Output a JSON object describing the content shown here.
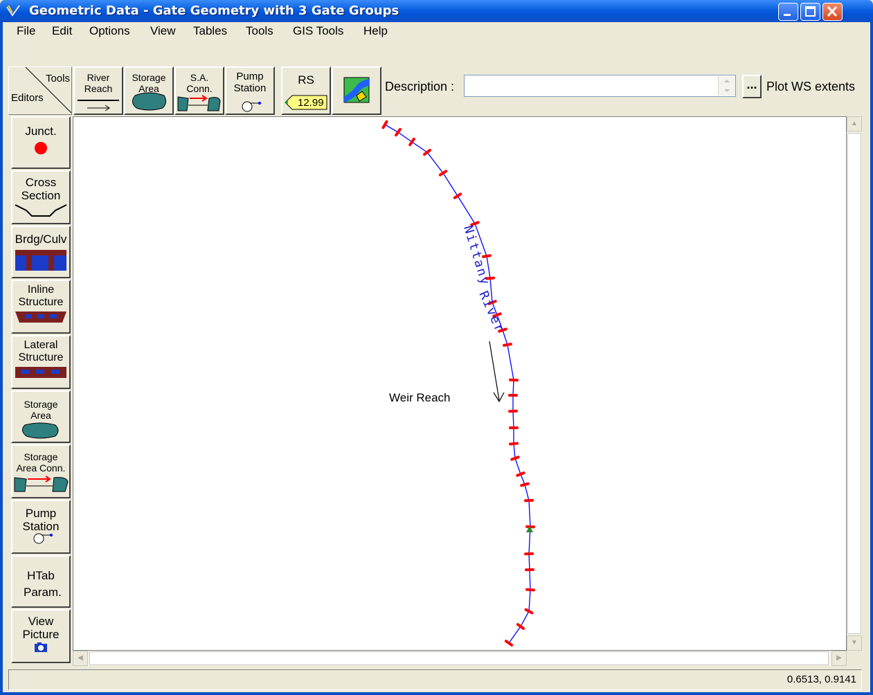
{
  "window": {
    "title": "Geometric Data - Gate Geometry with 3 Gate Groups",
    "colors": {
      "titlebar": "#0553d8",
      "background": "#ece9d8",
      "river_line": "#0000ff",
      "cross_section": "#ff0000"
    }
  },
  "menu": [
    "File",
    "Edit",
    "Options",
    "View",
    "Tables",
    "Tools",
    "GIS Tools",
    "Help"
  ],
  "toolbar": {
    "corner_tools": "Tools",
    "corner_editors": "Editors",
    "river_reach": "River Reach",
    "storage_area": "Storage Area",
    "sa_conn": "S.A. Conn.",
    "pump_station": "Pump Station",
    "rs_label": "RS",
    "rs_value": "12.99",
    "description_label": "Description :",
    "description_value": "",
    "dots_label": "...",
    "plot_ws": "Plot WS extents"
  },
  "side_buttons": {
    "junct": "Junct.",
    "cross_section": "Cross Section",
    "brdg_culv": "Brdg/Culv",
    "inline_structure": "Inline Structure",
    "lateral_structure": "Lateral Structure",
    "storage_area": "Storage Area",
    "storage_area_conn": "Storage Area Conn.",
    "pump_station": "Pump Station",
    "htab_param": "HTab Param.",
    "view_picture": "View Picture"
  },
  "canvas": {
    "river_name": "Nittany",
    "river_word2": "River",
    "reach_name": "Weir Reach"
  },
  "status": {
    "coords": "0.6513, 0.9141"
  }
}
